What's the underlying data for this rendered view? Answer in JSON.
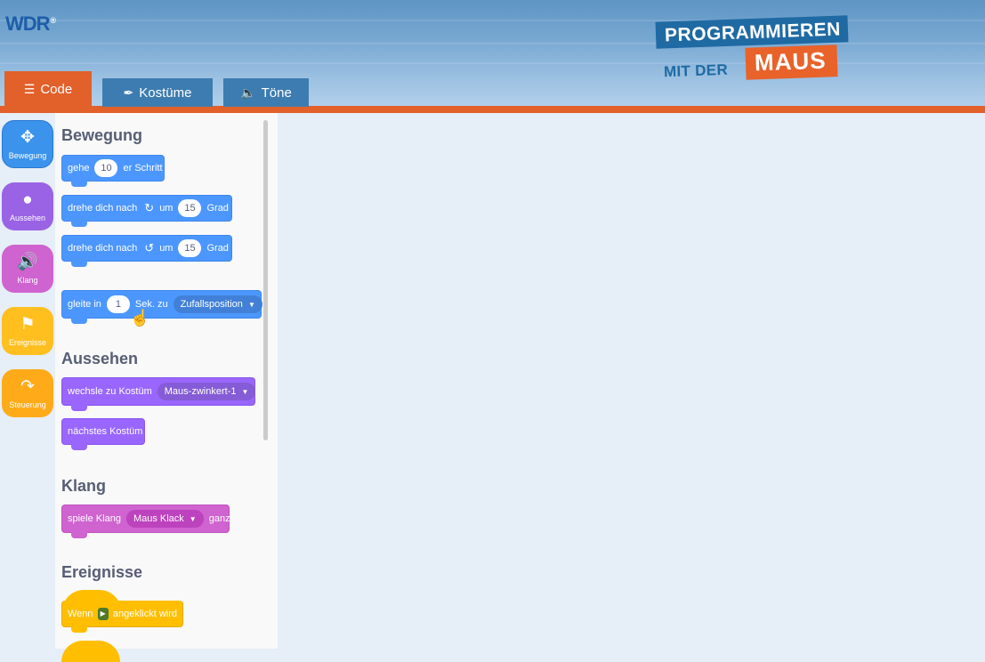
{
  "header": {
    "wdr_logo": "WDR",
    "wdr_mark": "®",
    "brand_line1": "PROGRAMMIEREN",
    "brand_line2": "MIT DER",
    "brand_line3": "MAUS"
  },
  "tabs": [
    {
      "label": "Code",
      "icon": "code-icon",
      "active": true
    },
    {
      "label": "Kostüme",
      "icon": "brush-icon",
      "active": false
    },
    {
      "label": "Töne",
      "icon": "speaker-icon",
      "active": false
    }
  ],
  "categories": [
    {
      "label": "Bewegung",
      "icon": "move-icon",
      "color": "#3b93ec"
    },
    {
      "label": "Aussehen",
      "icon": "person-icon",
      "color": "#9a63e5"
    },
    {
      "label": "Klang",
      "icon": "speaker-icon",
      "color": "#cf63cf"
    },
    {
      "label": "Ereignisse",
      "icon": "flag-icon",
      "color": "#ffbf1f"
    },
    {
      "label": "Steuerung",
      "icon": "shuffle-icon",
      "color": "#ffab19"
    }
  ],
  "palette": {
    "bewegung": {
      "title": "Bewegung",
      "move": {
        "pre": "gehe",
        "value": "10",
        "post": "er Schritt"
      },
      "turn_right": {
        "pre": "drehe dich nach",
        "mid": "um",
        "value": "15",
        "post": "Grad"
      },
      "turn_left": {
        "pre": "drehe dich nach",
        "mid": "um",
        "value": "15",
        "post": "Grad"
      },
      "glide": {
        "pre": "gleite in",
        "value": "1",
        "mid": "Sek. zu",
        "option": "Zufallsposition"
      }
    },
    "aussehen": {
      "title": "Aussehen",
      "switch_costume": {
        "pre": "wechsle zu Kostüm",
        "option": "Maus-zwinkert-1"
      },
      "next_costume": {
        "label": "nächstes Kostüm"
      }
    },
    "klang": {
      "title": "Klang",
      "play_sound": {
        "pre": "spiele Klang",
        "option": "Maus Klack",
        "post": "ganz"
      }
    },
    "ereignisse": {
      "title": "Ereignisse",
      "flag_clicked": {
        "pre": "Wenn",
        "post": "angeklickt wird"
      }
    }
  }
}
